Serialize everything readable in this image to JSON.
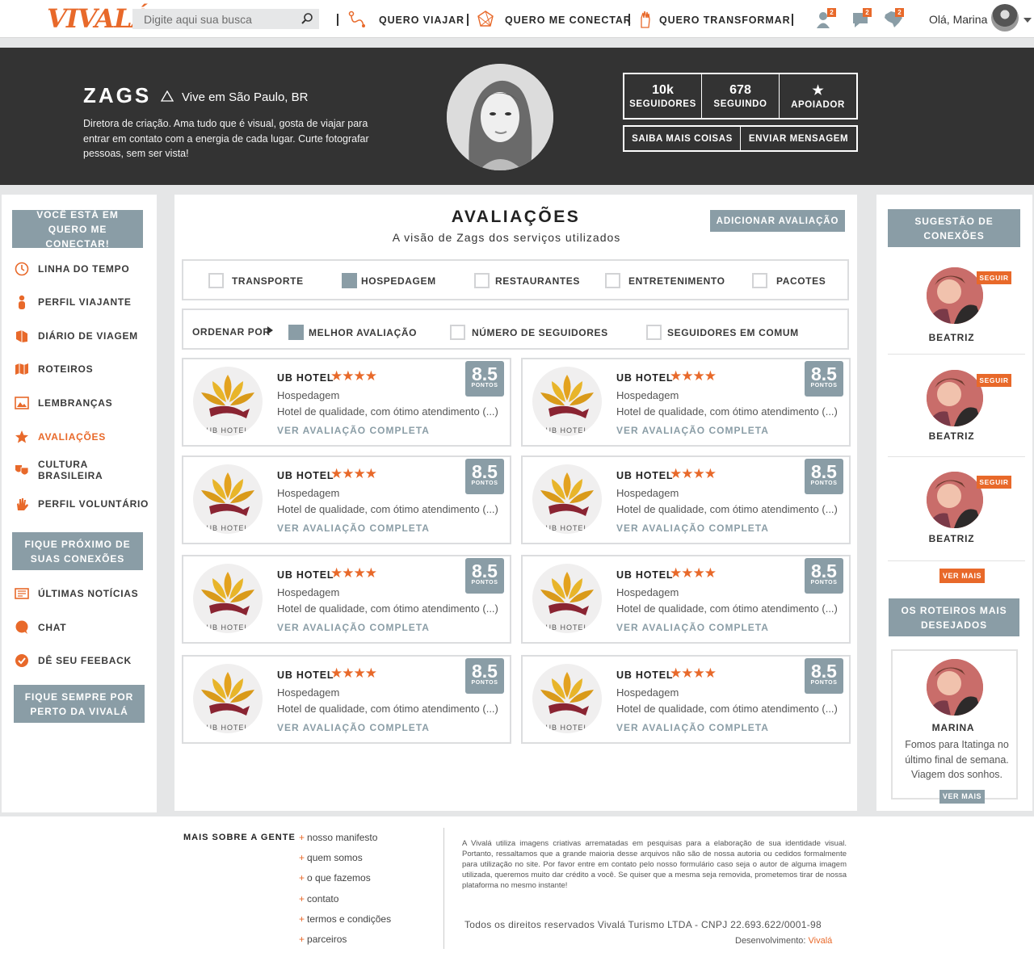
{
  "topbar": {
    "logo": "VIVALÁ",
    "search_placeholder": "Digite aqui sua busca",
    "nav": [
      {
        "label": "QUERO VIAJAR"
      },
      {
        "label": "QUERO ME CONECTAR"
      },
      {
        "label": "QUERO TRANSFORMAR"
      }
    ],
    "badges": [
      "2",
      "2",
      "2"
    ],
    "greeting": "Olá, Marina",
    "accent_color": "#e8692a"
  },
  "profile": {
    "name": "ZAGS",
    "location": "Vive em São Paulo, BR",
    "bio": "Diretora de criação. Ama tudo que é visual, gosta de viajar para entrar em contato com a energia de cada lugar. Curte fotografar pessoas, sem ser vista!",
    "stats": [
      {
        "value": "10k",
        "label": "SEGUIDORES"
      },
      {
        "value": "678",
        "label": "SEGUINDO"
      },
      {
        "value": "★",
        "label": "APOIADOR"
      }
    ],
    "actions": [
      "SAIBA MAIS COISAS",
      "ENVIAR MENSAGEM"
    ]
  },
  "left_sidebar": {
    "context_label": "VOCÊ ESTÁ EM QUERO ME CONECTAR!",
    "menu": [
      {
        "label": "LINHA DO TEMPO",
        "icon": "clock-icon"
      },
      {
        "label": "PERFIL VIAJANTE",
        "icon": "person-icon"
      },
      {
        "label": "DIÁRIO DE VIAGEM",
        "icon": "book-icon"
      },
      {
        "label": "ROTEIROS",
        "icon": "map-icon"
      },
      {
        "label": "LEMBRANÇAS",
        "icon": "picture-icon"
      },
      {
        "label": "AVALIAÇÕES",
        "icon": "star-icon",
        "active": true
      },
      {
        "label": "CULTURA BRASILEIRA",
        "icon": "masks-icon"
      },
      {
        "label": "PERFIL VOLUNTÁRIO",
        "icon": "hand-icon"
      }
    ],
    "section_label": "FIQUE PRÓXIMO DE SUAS CONEXÕES",
    "menu2": [
      {
        "label": "ÚLTIMAS NOTÍCIAS",
        "icon": "newspaper-icon"
      },
      {
        "label": "CHAT",
        "icon": "chat-icon"
      },
      {
        "label": "DÊ SEU FEEBACK",
        "icon": "check-icon"
      }
    ],
    "bottom_button": "FIQUE SEMPRE POR PERTO DA VIVALÁ"
  },
  "main": {
    "title": "AVALIAÇÕES",
    "subtitle": "A visão de Zags dos serviços utilizados",
    "add_button": "ADICIONAR AVALIAÇÃO",
    "categories": [
      {
        "label": "TRANSPORTE",
        "checked": false
      },
      {
        "label": "HOSPEDAGEM",
        "checked": true
      },
      {
        "label": "RESTAURANTES",
        "checked": false
      },
      {
        "label": "ENTRETENIMENTO",
        "checked": false
      },
      {
        "label": "PACOTES",
        "checked": false
      }
    ],
    "sort_label": "ORDENAR POR",
    "sort_options": [
      {
        "label": "MELHOR AVALIAÇÃO",
        "checked": true
      },
      {
        "label": "NÚMERO DE SEGUIDORES",
        "checked": false
      },
      {
        "label": "SEGUIDORES EM COMUM",
        "checked": false
      }
    ],
    "reviews": [
      {
        "name": "UB HOTEL",
        "stars": 4,
        "category": "Hospedagem",
        "desc": "Hotel de qualidade, com ótimo atendimento (...)",
        "link": "VER AVALIAÇÃO COMPLETA",
        "score": "8.5",
        "score_unit": "PONTOS",
        "logo_text": "UB HOTEL"
      },
      {
        "name": "UB HOTEL",
        "stars": 4,
        "category": "Hospedagem",
        "desc": "Hotel de qualidade, com ótimo atendimento (...)",
        "link": "VER AVALIAÇÃO COMPLETA",
        "score": "8.5",
        "score_unit": "PONTOS",
        "logo_text": "UB HOTEL"
      },
      {
        "name": "UB HOTEL",
        "stars": 4,
        "category": "Hospedagem",
        "desc": "Hotel de qualidade, com ótimo atendimento (...)",
        "link": "VER AVALIAÇÃO COMPLETA",
        "score": "8.5",
        "score_unit": "PONTOS",
        "logo_text": "UB HOTEL"
      },
      {
        "name": "UB HOTEL",
        "stars": 4,
        "category": "Hospedagem",
        "desc": "Hotel de qualidade, com ótimo atendimento (...)",
        "link": "VER AVALIAÇÃO COMPLETA",
        "score": "8.5",
        "score_unit": "PONTOS",
        "logo_text": "UB HOTEL"
      },
      {
        "name": "UB HOTEL",
        "stars": 4,
        "category": "Hospedagem",
        "desc": "Hotel de qualidade, com ótimo atendimento (...)",
        "link": "VER AVALIAÇÃO COMPLETA",
        "score": "8.5",
        "score_unit": "PONTOS",
        "logo_text": "UB HOTEL"
      },
      {
        "name": "UB HOTEL",
        "stars": 4,
        "category": "Hospedagem",
        "desc": "Hotel de qualidade, com ótimo atendimento (...)",
        "link": "VER AVALIAÇÃO COMPLETA",
        "score": "8.5",
        "score_unit": "PONTOS",
        "logo_text": "UB HOTEL"
      },
      {
        "name": "UB HOTEL",
        "stars": 4,
        "category": "Hospedagem",
        "desc": "Hotel de qualidade, com ótimo atendimento (...)",
        "link": "VER AVALIAÇÃO COMPLETA",
        "score": "8.5",
        "score_unit": "PONTOS",
        "logo_text": "UB HOTEL"
      },
      {
        "name": "UB HOTEL",
        "stars": 4,
        "category": "Hospedagem",
        "desc": "Hotel de qualidade, com ótimo atendimento (...)",
        "link": "VER AVALIAÇÃO COMPLETA",
        "score": "8.5",
        "score_unit": "PONTOS",
        "logo_text": "UB HOTEL"
      }
    ]
  },
  "right_sidebar": {
    "suggestions_title": "SUGESTÃO DE CONEXÕES",
    "follow_label": "SEGUIR",
    "suggestions": [
      {
        "name": "BEATRIZ"
      },
      {
        "name": "BEATRIZ"
      },
      {
        "name": "BEATRIZ"
      }
    ],
    "see_more": "VER MAIS",
    "routes_title": "OS ROTEIROS MAIS DESEJADOS",
    "route": {
      "name": "MARINA",
      "text": "Fomos para Itatinga no último final de semana. Viagem dos sonhos."
    },
    "route_see_more": "VER MAIS"
  },
  "footer": {
    "title": "MAIS SOBRE A GENTE",
    "links": [
      "nosso manifesto",
      "quem somos",
      "o que fazemos",
      "contato",
      "termos e condições",
      "parceiros"
    ],
    "disclaimer": "A Vivalá utiliza imagens criativas arrematadas em pesquisas para a elaboração de sua identidade visual. Portanto, ressaltamos que a grande maioria desse arquivos não são de nossa autoria ou cedidos formalmente para utilização no site. Por favor entre em contato pelo nosso formulário caso seja o autor de alguma imagem utilizada, queremos muito dar crédito a você. Se quiser que a mesma seja removida, prometemos tirar de nossa plataforma no mesmo instante!",
    "rights": "Todos os direitos reservados Vivalá Turismo LTDA   -   CNPJ 22.693.622/0001-98",
    "dev_label": "Desenvolvimento:",
    "dev_name": "Vivalá"
  }
}
